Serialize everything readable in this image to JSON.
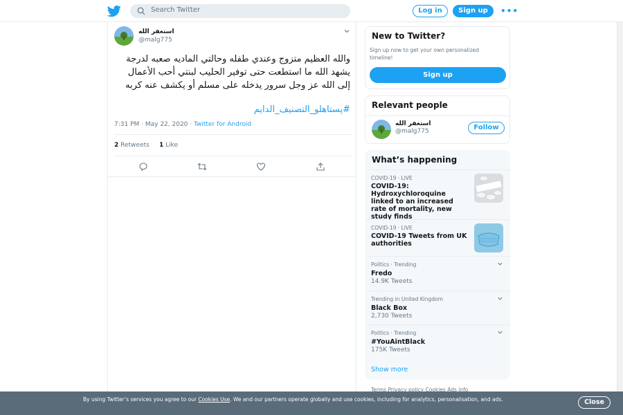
{
  "header": {
    "search_placeholder": "Search Twitter",
    "login_label": "Log in",
    "signup_label": "Sign up",
    "more_label": "•••"
  },
  "tweet": {
    "author_name": "استغفر الله",
    "author_handle": "@malg775",
    "text": "والله العظيم متزوج وعندي طفله وحالتي الماديه صعبه لدرجة يشهد الله ما استطعت حتى توفير الحليب لبنتي أحب الأعمال إلى الله عز وجل سرور يدخله على مسلم أو يكشف عنه كربه",
    "hashtag": "#يستاهلو_التصنيف_الدايم",
    "time": "7:31 PM · May 22, 2020",
    "separator": " · ",
    "source": "Twitter for Android",
    "retweets_count": "2",
    "retweets_label": "Retweets",
    "likes_count": "1",
    "likes_label": "Like"
  },
  "new_to_twitter": {
    "title": "New to Twitter?",
    "description": "Sign up now to get your own personalized timeline!",
    "signup_label": "Sign up"
  },
  "relevant_people": {
    "title": "Relevant people",
    "name": "استغفر الله",
    "handle": "@malg775",
    "follow_label": "Follow"
  },
  "whats_happening": {
    "title": "What’s happening",
    "trends": [
      {
        "context": "COVID-19 · LIVE",
        "title": "COVID-19: Hydroxychloroquine linked to an increased rate of mortality, new study finds",
        "count": ""
      },
      {
        "context": "COVID-19 · LIVE",
        "title": "COVID-19 Tweets from UK authorities",
        "count": ""
      },
      {
        "context": "Politics · Trending",
        "title": "Fredo",
        "count": "14.9K Tweets"
      },
      {
        "context": "Trending in United Kingdom",
        "title": "Black Box",
        "count": "2,730 Tweets"
      },
      {
        "context": "Politics · Trending",
        "title": "#YouAintBlack",
        "count": "175K Tweets"
      }
    ],
    "show_more": "Show more"
  },
  "footer": {
    "links": "Terms   Privacy policy   Cookies   Ads info"
  },
  "cookie_banner": {
    "text_before": "By using Twitter’s services you agree to our ",
    "link": "Cookies Use",
    "text_after": ". We and our partners operate globally and use cookies, including for analytics, personalisation, and ads.",
    "close_label": "Close"
  },
  "colors": {
    "accent": "#1da1f2",
    "banner": "#5a6b7a",
    "muted_text": "#657786"
  }
}
